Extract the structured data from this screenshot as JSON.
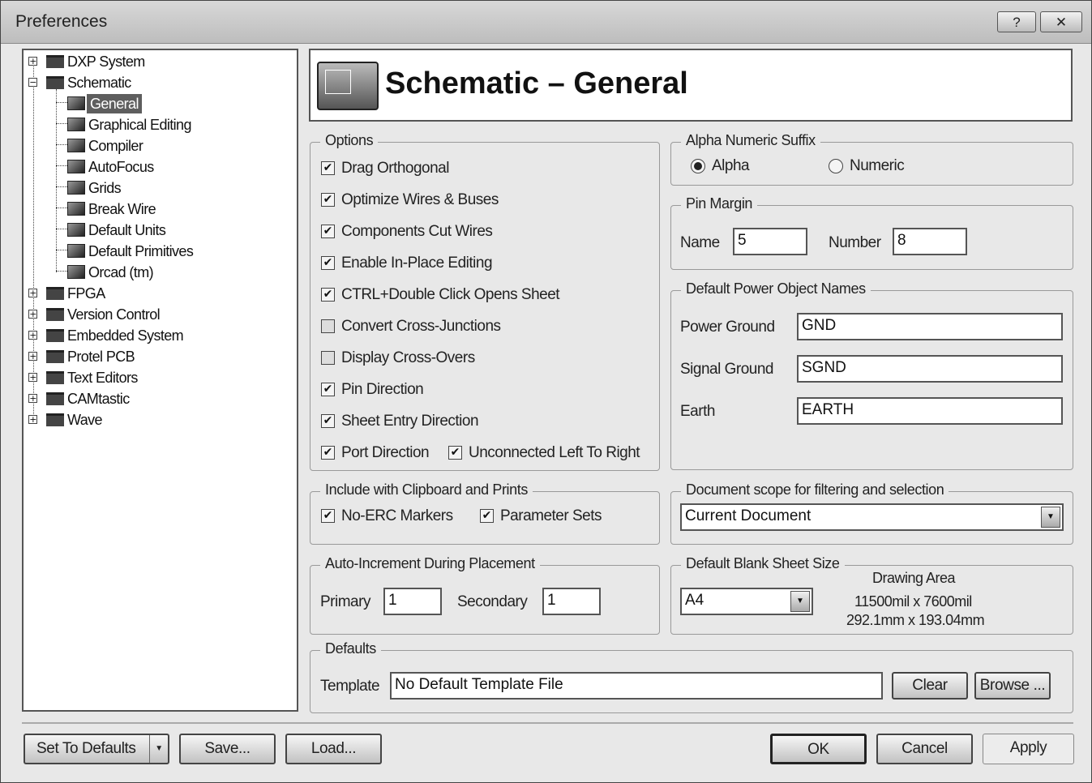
{
  "window": {
    "title": "Preferences",
    "help_label": "?",
    "close_label": "✕"
  },
  "tree": {
    "items": [
      {
        "label": "DXP System",
        "expander": "+"
      },
      {
        "label": "Schematic",
        "expander": "−"
      },
      {
        "label": "General"
      },
      {
        "label": "Graphical Editing"
      },
      {
        "label": "Compiler"
      },
      {
        "label": "AutoFocus"
      },
      {
        "label": "Grids"
      },
      {
        "label": "Break Wire"
      },
      {
        "label": "Default Units"
      },
      {
        "label": "Default Primitives"
      },
      {
        "label": "Orcad (tm)"
      },
      {
        "label": "FPGA",
        "expander": "+"
      },
      {
        "label": "Version Control",
        "expander": "+"
      },
      {
        "label": "Embedded System",
        "expander": "+"
      },
      {
        "label": "Protel PCB",
        "expander": "+"
      },
      {
        "label": "Text Editors",
        "expander": "+"
      },
      {
        "label": "CAMtastic",
        "expander": "+"
      },
      {
        "label": "Wave",
        "expander": "+"
      }
    ]
  },
  "header": {
    "title": "Schematic – General"
  },
  "options": {
    "legend": "Options",
    "items": [
      {
        "label": "Drag Orthogonal",
        "checked": true,
        "mark": "✔"
      },
      {
        "label": "Optimize Wires & Buses",
        "checked": true,
        "mark": "✔"
      },
      {
        "label": "Components Cut Wires",
        "checked": true,
        "mark": "✔"
      },
      {
        "label": "Enable In-Place Editing",
        "checked": true,
        "mark": "✔"
      },
      {
        "label": "CTRL+Double Click Opens Sheet",
        "checked": true,
        "mark": "✔"
      },
      {
        "label": "Convert Cross-Junctions",
        "checked": false,
        "mark": ""
      },
      {
        "label": "Display Cross-Overs",
        "checked": false,
        "mark": ""
      },
      {
        "label": "Pin Direction",
        "checked": true,
        "mark": "✔"
      },
      {
        "label": "Sheet Entry Direction",
        "checked": true,
        "mark": "✔"
      },
      {
        "label": "Port Direction",
        "checked": true,
        "mark": "✔"
      },
      {
        "label": "Unconnected Left To Right",
        "checked": true,
        "mark": "✔"
      }
    ]
  },
  "clipboard": {
    "legend": "Include with Clipboard and Prints",
    "items": [
      {
        "label": "No-ERC Markers",
        "checked": true,
        "mark": "✔"
      },
      {
        "label": "Parameter Sets",
        "checked": true,
        "mark": "✔"
      }
    ]
  },
  "auto_increment": {
    "legend": "Auto-Increment During Placement",
    "primary_label": "Primary",
    "primary_value": "1",
    "secondary_label": "Secondary",
    "secondary_value": "1"
  },
  "alpha_suffix": {
    "legend": "Alpha Numeric Suffix",
    "alpha_label": "Alpha",
    "numeric_label": "Numeric",
    "selected": "Alpha"
  },
  "pin_margin": {
    "legend": "Pin Margin",
    "name_label": "Name",
    "name_value": "5",
    "number_label": "Number",
    "number_value": "8"
  },
  "power_names": {
    "legend": "Default Power Object Names",
    "power_ground_label": "Power Ground",
    "power_ground_value": "GND",
    "signal_ground_label": "Signal Ground",
    "signal_ground_value": "SGND",
    "earth_label": "Earth",
    "earth_value": "EARTH"
  },
  "doc_scope": {
    "legend": "Document scope for filtering and selection",
    "value": "Current Document"
  },
  "sheet_size": {
    "legend": "Default Blank Sheet Size",
    "value": "A4",
    "drawing_area_label": "Drawing Area",
    "size_mil": "11500mil x 7600mil",
    "size_mm": "292.1mm x 193.04mm"
  },
  "defaults": {
    "legend": "Defaults",
    "template_label": "Template",
    "template_value": "No Default Template File",
    "clear_label": "Clear",
    "browse_label": "Browse ..."
  },
  "footer": {
    "set_defaults_label": "Set To Defaults",
    "save_label": "Save...",
    "load_label": "Load...",
    "ok_label": "OK",
    "cancel_label": "Cancel",
    "apply_label": "Apply"
  },
  "icons": {
    "dropdown": "chevron-down-icon",
    "folder": "folder-icon",
    "page": "page-icon",
    "schematic": "schematic-icon"
  }
}
